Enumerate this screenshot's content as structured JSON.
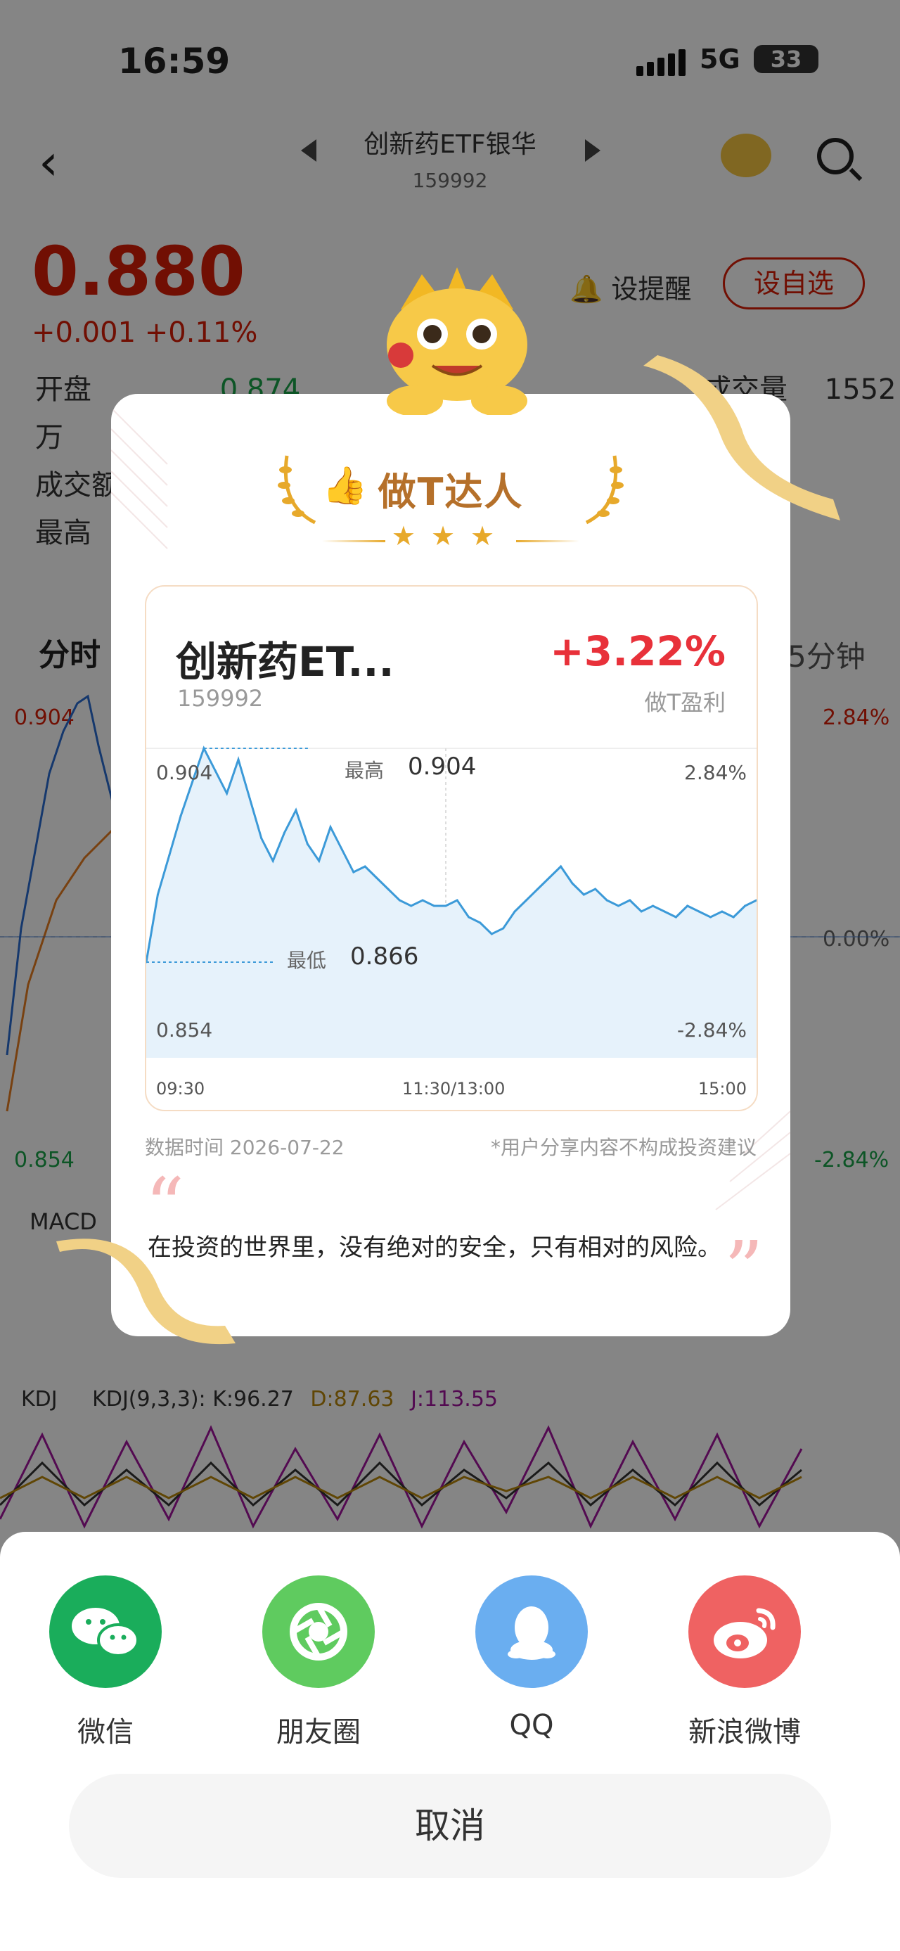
{
  "status": {
    "time": "16:59",
    "network": "5G",
    "battery": "33"
  },
  "header": {
    "title": "创新药ETF银华",
    "code": "159992",
    "remind_label": "设提醒",
    "fav_label": "设自选"
  },
  "quote": {
    "price": "0.880",
    "change": "+0.001  +0.11%",
    "open_label": "开盘",
    "open_value": "0.874",
    "volume_label": "成交量",
    "volume_value": "1552万",
    "turnover_label": "成交额",
    "high_label": "最高",
    "tab_fenshi": "分时",
    "tab_5min": "5分钟"
  },
  "bg_chart": {
    "left_top": "0.904",
    "left_low": "0.854",
    "right_top": "2.84%",
    "right_mid": "0.00%",
    "right_bot": "-2.84%",
    "macd_label": "MACD",
    "kdj_label": "KDJ",
    "kdj_params": "KDJ(9,3,3):",
    "k_value": "K:96.27",
    "d_value": "D:87.63",
    "j_value": "J:113.55"
  },
  "card": {
    "title": "做T达人",
    "fund_name": "创新药ET...",
    "fund_code": "159992",
    "profit_pct": "+3.22%",
    "profit_label": "做T盈利",
    "high_label": "最高",
    "high_value": "0.904",
    "low_label": "最低",
    "low_value": "0.866",
    "y_top_left": "0.904",
    "y_bot_left": "0.854",
    "y_top_right": "2.84%",
    "y_bot_right": "-2.84%",
    "x_start": "09:30",
    "x_mid": "11:30/13:00",
    "x_end": "15:00",
    "data_time": "数据时间 2026-07-22",
    "disclaimer": "*用户分享内容不构成投资建议",
    "quote_text": "在投资的世界里，没有绝对的安全，只有相对的风险。"
  },
  "chart_data": {
    "type": "line",
    "title": "",
    "xlabel": "",
    "ylabel": "",
    "x_ticks": [
      "09:30",
      "11:30/13:00",
      "15:00"
    ],
    "ylim": [
      0.854,
      0.904
    ],
    "y_ticks_left": [
      "0.904",
      "0.854"
    ],
    "y_ticks_right": [
      "2.84%",
      "-2.84%"
    ],
    "annotations": [
      {
        "label": "最高",
        "value": 0.904
      },
      {
        "label": "最低",
        "value": 0.866
      }
    ],
    "series": [
      {
        "values": [
          0.866,
          0.878,
          0.885,
          0.892,
          0.898,
          0.904,
          0.9,
          0.896,
          0.902,
          0.895,
          0.888,
          0.884,
          0.889,
          0.893,
          0.887,
          0.884,
          0.89,
          0.886,
          0.882,
          0.883,
          0.881,
          0.879,
          0.877,
          0.876,
          0.877,
          0.876,
          0.876,
          0.877,
          0.874,
          0.873,
          0.871,
          0.872,
          0.875,
          0.877,
          0.879,
          0.881,
          0.883,
          0.88,
          0.878,
          0.879,
          0.877,
          0.876,
          0.877,
          0.875,
          0.876,
          0.875,
          0.874,
          0.876,
          0.875,
          0.874,
          0.875,
          0.874,
          0.876,
          0.877
        ]
      }
    ],
    "grid": true
  },
  "share": {
    "items": [
      {
        "label": "微信",
        "color": "#1aad5b",
        "icon": "wechat-icon"
      },
      {
        "label": "朋友圈",
        "color": "#5fcb5f",
        "icon": "moments-icon"
      },
      {
        "label": "QQ",
        "color": "#6aaef0",
        "icon": "qq-icon"
      },
      {
        "label": "新浪微博",
        "color": "#ef6262",
        "icon": "weibo-icon"
      }
    ],
    "cancel_label": "取消"
  }
}
